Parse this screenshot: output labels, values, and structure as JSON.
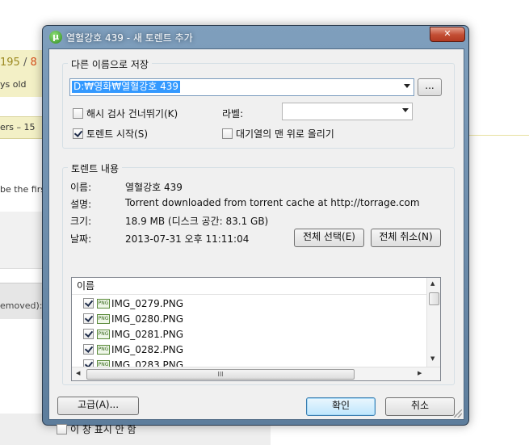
{
  "background": {
    "stats_a": "195",
    "stats_sep": " / ",
    "stats_b": "8",
    "age": "ys old",
    "peers": "ers – 15",
    "first": "be the firs",
    "removed": "emoved):"
  },
  "window": {
    "title": "열혈강호 439 - 새 토렌트 추가",
    "close_glyph": "✕"
  },
  "save": {
    "legend": "다른 이름으로 저장",
    "path": "D:₩영화₩열혈강호 439",
    "browse_label": "...",
    "skip_hash_label": "해시 검사 건너뛰기(K)",
    "skip_hash_checked": false,
    "label_text": "라벨:",
    "label_value": "",
    "start_label": "토렌트 시작(S)",
    "start_checked": true,
    "top_queue_label": "대기열의 맨 위로 올리기",
    "top_queue_checked": false
  },
  "content": {
    "legend": "토렌트 내용",
    "name_key": "이름:",
    "name_val": "열혈강호 439",
    "desc_key": "설명:",
    "desc_val": "Torrent downloaded from torrent cache at http://torrage.com",
    "size_key": "크기:",
    "size_val": "18.9 MB (디스크 공간: 83.1 GB)",
    "date_key": "날짜:",
    "date_val": "2013-07-31 오후 11:11:04",
    "select_all": "전체 선택(E)",
    "deselect_all": "전체 취소(N)",
    "list_header": "이름",
    "files": [
      {
        "name": "IMG_0279.PNG",
        "checked": true
      },
      {
        "name": "IMG_0280.PNG",
        "checked": true
      },
      {
        "name": "IMG_0281.PNG",
        "checked": true
      },
      {
        "name": "IMG_0282.PNG",
        "checked": true
      },
      {
        "name": "IMG_0283.PNG",
        "checked": true
      }
    ],
    "file_icon_text": "PNG",
    "hscroll_grip": "III"
  },
  "footer": {
    "advanced": "고급(A)...",
    "ok": "확인",
    "cancel": "취소",
    "dont_show": "이 창 표시 안 함",
    "dont_show_checked": false
  },
  "colors": {
    "title_gradient_top": "#7f9fbd",
    "selection": "#3399ff",
    "close_red": "#c24d33"
  }
}
